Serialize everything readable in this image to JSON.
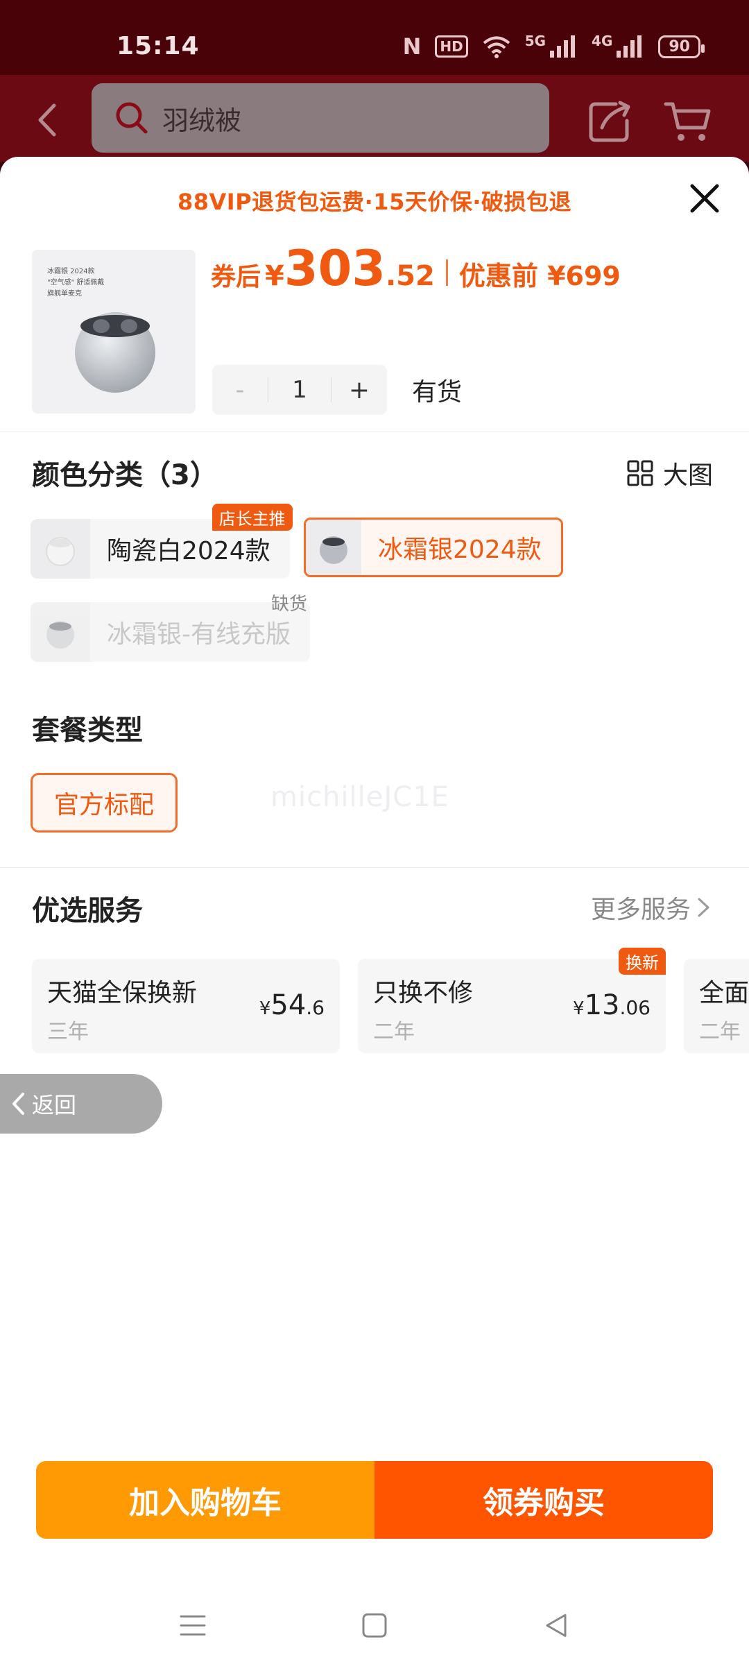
{
  "status_bar": {
    "time": "15:14",
    "nfc": "N",
    "hd": "HD",
    "net1": "5G",
    "net2": "4G",
    "battery": "90"
  },
  "header": {
    "search_text": "羽绒被"
  },
  "sheet": {
    "vip_banner": "88VIP退货包运费·15天价保·破损包退",
    "thumb_text": [
      "冰霜银 2024款",
      "\"空气感\" 舒适佩戴",
      "旗舰单麦克"
    ],
    "price": {
      "prefix": "券后",
      "currency": "¥",
      "integer": "303",
      "decimal": ".52",
      "original": "优惠前 ¥699"
    },
    "quantity": {
      "minus": "-",
      "value": "1",
      "plus": "+"
    },
    "stock": "有货"
  },
  "color_section": {
    "title": "颜色分类（3）",
    "bigpic_label": "大图",
    "options": [
      {
        "label": "陶瓷白2024款",
        "tag": "店长主推",
        "state": "normal"
      },
      {
        "label": "冰霜银2024款",
        "tag": "",
        "state": "selected"
      },
      {
        "label": "冰霜银-有线充版",
        "tag": "缺货",
        "state": "disabled"
      }
    ]
  },
  "package_section": {
    "title": "套餐类型",
    "option": "官方标配"
  },
  "watermark": "michilleJC1E",
  "service_section": {
    "title": "优选服务",
    "more": "更多服务",
    "cards": [
      {
        "name": "天猫全保换新",
        "sub": "三年",
        "currency": "¥",
        "integer": "54",
        "decimal": ".6",
        "tag": ""
      },
      {
        "name": "只换不修",
        "sub": "二年",
        "currency": "¥",
        "integer": "13",
        "decimal": ".06",
        "tag": "换新"
      },
      {
        "name": "全面",
        "sub": "二年",
        "currency": "",
        "integer": "",
        "decimal": "",
        "tag": ""
      }
    ]
  },
  "float_back": "返回",
  "actions": {
    "add_to_cart": "加入购物车",
    "buy": "领券购买"
  },
  "colors": {
    "accent": "#f05a10",
    "cart_button": "#ff9a05",
    "buy_button": "#ff5500"
  }
}
